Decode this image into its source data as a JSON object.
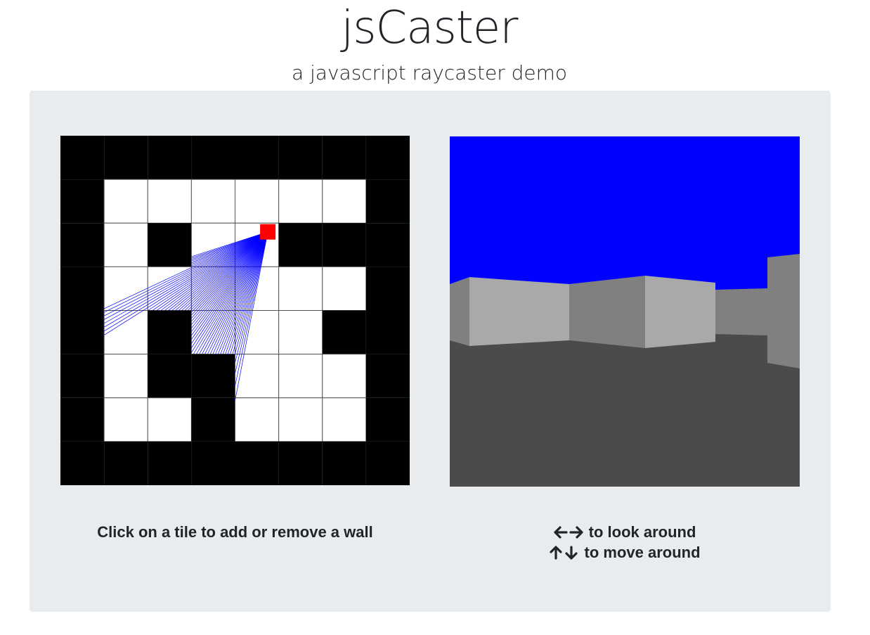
{
  "header": {
    "title": "jsCaster",
    "subtitle": "a javascript raycaster demo"
  },
  "map": {
    "grid": [
      [
        1,
        1,
        1,
        1,
        1,
        1,
        1,
        1
      ],
      [
        1,
        0,
        0,
        0,
        0,
        0,
        0,
        1
      ],
      [
        1,
        0,
        1,
        0,
        0,
        1,
        1,
        1
      ],
      [
        1,
        0,
        0,
        0,
        0,
        0,
        0,
        1
      ],
      [
        1,
        0,
        1,
        0,
        0,
        0,
        1,
        1
      ],
      [
        1,
        0,
        1,
        1,
        0,
        0,
        0,
        1
      ],
      [
        1,
        0,
        0,
        1,
        0,
        0,
        0,
        1
      ],
      [
        1,
        1,
        1,
        1,
        1,
        1,
        1,
        1
      ]
    ],
    "wall_color": "#000000",
    "floor_color": "#ffffff",
    "player_color": "#ff0000",
    "ray_color": "#0000ff",
    "player_cell": [
      4.75,
      2.2
    ],
    "instruction": "Click on a tile to add or remove a wall"
  },
  "view": {
    "sky_color": "#0000ff",
    "floor_color": "#4b4b4b",
    "wall_light": "#a9a9a9",
    "wall_dark": "#808080"
  },
  "controls": {
    "look_icons": [
      "arrow-left-icon",
      "arrow-right-icon"
    ],
    "look_text": "to look around",
    "move_icons": [
      "arrow-up-icon",
      "arrow-down-icon"
    ],
    "move_text": "to move around"
  }
}
